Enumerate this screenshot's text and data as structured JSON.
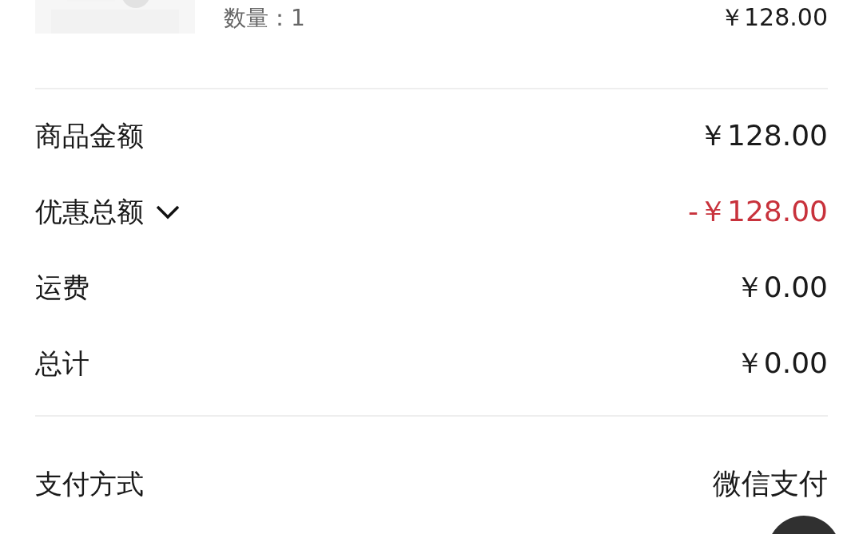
{
  "product": {
    "quantity": "数量：1",
    "price": "￥128.00"
  },
  "summary": [
    {
      "kind": "plain",
      "label": "商品金额",
      "value": "￥128.00"
    },
    {
      "kind": "discount",
      "label": "优惠总额",
      "value": "-￥128.00",
      "expanded": false
    },
    {
      "kind": "plain",
      "label": "运费",
      "value": "￥0.00"
    },
    {
      "kind": "plain",
      "label": "总计",
      "value": "￥0.00"
    }
  ],
  "payment": {
    "label": "支付方式",
    "value": "微信支付"
  }
}
